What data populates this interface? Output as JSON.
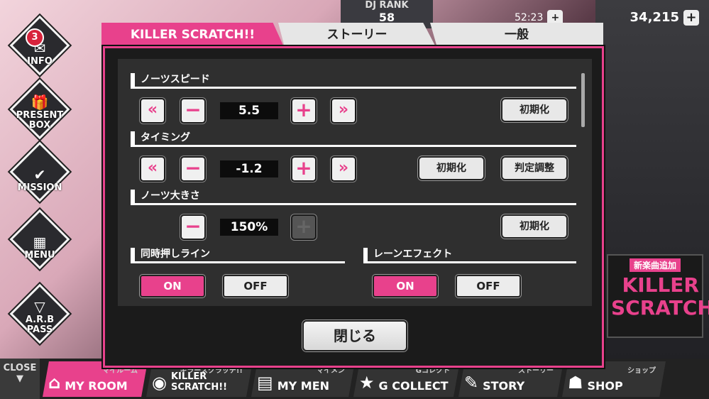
{
  "background": {
    "side_buttons": [
      {
        "label": "INFO",
        "icon": "mail-icon",
        "glyph": "✉",
        "badge": "3"
      },
      {
        "label": "PRESENT\nBOX",
        "icon": "gift-icon",
        "glyph": "🎁"
      },
      {
        "label": "MISSION",
        "icon": "checkmark-icon",
        "glyph": "✔"
      },
      {
        "label": "MENU",
        "icon": "grid-icon",
        "glyph": "▦"
      },
      {
        "label": "A.R.B\nPASS",
        "icon": "pass-icon",
        "glyph": "▽"
      }
    ],
    "dj_rank_label": "DJ RANK",
    "dj_rank_value": "58",
    "timer": "52:23",
    "currency": "34,215",
    "promo_tag": "新楽曲追加",
    "promo_title": "KILLER\nSCRATCH!!"
  },
  "tabs": [
    {
      "label": "KILLER SCRATCH!!",
      "active": true
    },
    {
      "label": "ストーリー",
      "active": false
    },
    {
      "label": "一般",
      "active": false
    }
  ],
  "settings": {
    "notes_speed": {
      "title": "ノーツスピード",
      "value": "5.5",
      "reset": "初期化"
    },
    "timing": {
      "title": "タイミング",
      "value": "-1.2",
      "reset": "初期化",
      "adjust": "判定調整"
    },
    "notes_size": {
      "title": "ノーツ大きさ",
      "value": "150%",
      "reset": "初期化"
    },
    "simultaneous_line": {
      "title": "同時押しライン",
      "on": "ON",
      "off": "OFF",
      "selected": "ON"
    },
    "lane_effect": {
      "title": "レーンエフェクト",
      "on": "ON",
      "off": "OFF",
      "selected": "ON"
    }
  },
  "controls": {
    "fast_down": "«",
    "down": "−",
    "up": "+",
    "fast_up": "»"
  },
  "close_label": "閉じる",
  "navbar": {
    "close_label": "CLOSE",
    "close_arrow": "▼",
    "items": [
      {
        "label": "MY ROOM",
        "sub": "マイルーム",
        "icon": "house-icon",
        "glyph": "⌂",
        "active": true
      },
      {
        "label": "KILLER SCRATCH!!",
        "sub": "キラースクラッチ!!",
        "icon": "disc-icon",
        "glyph": "◉",
        "active": false
      },
      {
        "label": "MY MEN",
        "sub": "マイメン",
        "icon": "cards-icon",
        "glyph": "▤",
        "active": false
      },
      {
        "label": "G COLLECT",
        "sub": "Gコレクト",
        "icon": "star-icon",
        "glyph": "★",
        "active": false
      },
      {
        "label": "STORY",
        "sub": "ストーリー",
        "icon": "book-icon",
        "glyph": "✎",
        "active": false
      },
      {
        "label": "SHOP",
        "sub": "ショップ",
        "icon": "shop-icon",
        "glyph": "☗",
        "active": false
      }
    ]
  },
  "colors": {
    "accent": "#e8418c",
    "panel": "#2f2f2f",
    "dialog_bg": "#1b1b1b"
  }
}
